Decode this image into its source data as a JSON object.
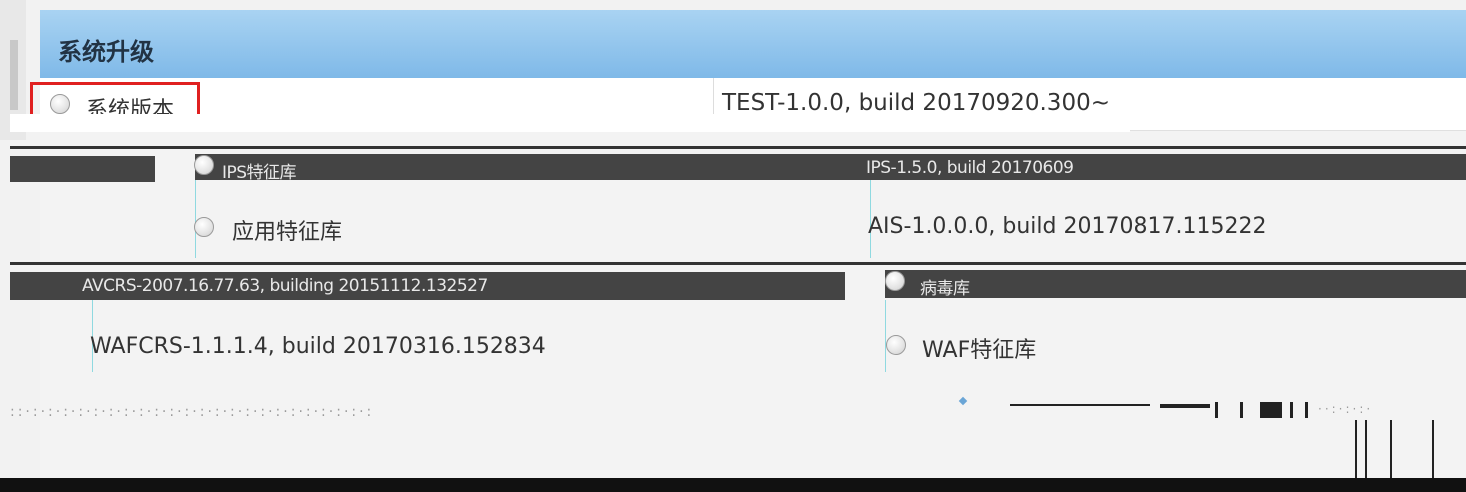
{
  "header": {
    "title": "系统升级"
  },
  "rows": {
    "system_version": {
      "label": "系统版本",
      "value": "TEST-1.0.0, build 20170920.300~"
    },
    "ips": {
      "label": "IPS特征库",
      "value": "IPS-1.5.0, build 20170609"
    },
    "app": {
      "label": "应用特征库",
      "value": "AIS-1.0.0.0, build 20170817.115222"
    },
    "av": {
      "label": "病毒库",
      "value": "AVCRS-2007.16.77.63, building 20151112.132527"
    },
    "wafcrs": {
      "value": "WAFCRS-1.1.1.4, build 20170316.152834"
    },
    "waf": {
      "label": "WAF特征库"
    }
  }
}
